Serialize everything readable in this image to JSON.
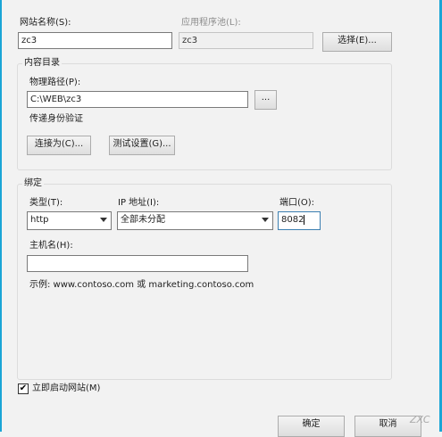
{
  "site": {
    "name_label": "网站名称(S):",
    "name_value": "zc3"
  },
  "app_pool": {
    "label": "应用程序池(L):",
    "value": "zc3",
    "select_button": "选择(E)..."
  },
  "content_dir": {
    "group_title": "内容目录",
    "path_label": "物理路径(P):",
    "path_value": "C:\\WEB\\zc3",
    "browse_button": "...",
    "pass_through_label": "传递身份验证",
    "connect_as_button": "连接为(C)...",
    "test_settings_button": "测试设置(G)..."
  },
  "binding": {
    "group_title": "绑定",
    "type_label": "类型(T):",
    "type_value": "http",
    "ip_label": "IP 地址(I):",
    "ip_value": "全部未分配",
    "port_label": "端口(O):",
    "port_value": "8082",
    "host_label": "主机名(H):",
    "host_value": "",
    "example_text": "示例: www.contoso.com 或 marketing.contoso.com"
  },
  "start_immediately": {
    "label": "立即启动网站(M)",
    "checked": true,
    "check_glyph": "✔"
  },
  "footer": {
    "ok_button": "确定",
    "cancel_button": "取消"
  },
  "watermark": "ZXC"
}
